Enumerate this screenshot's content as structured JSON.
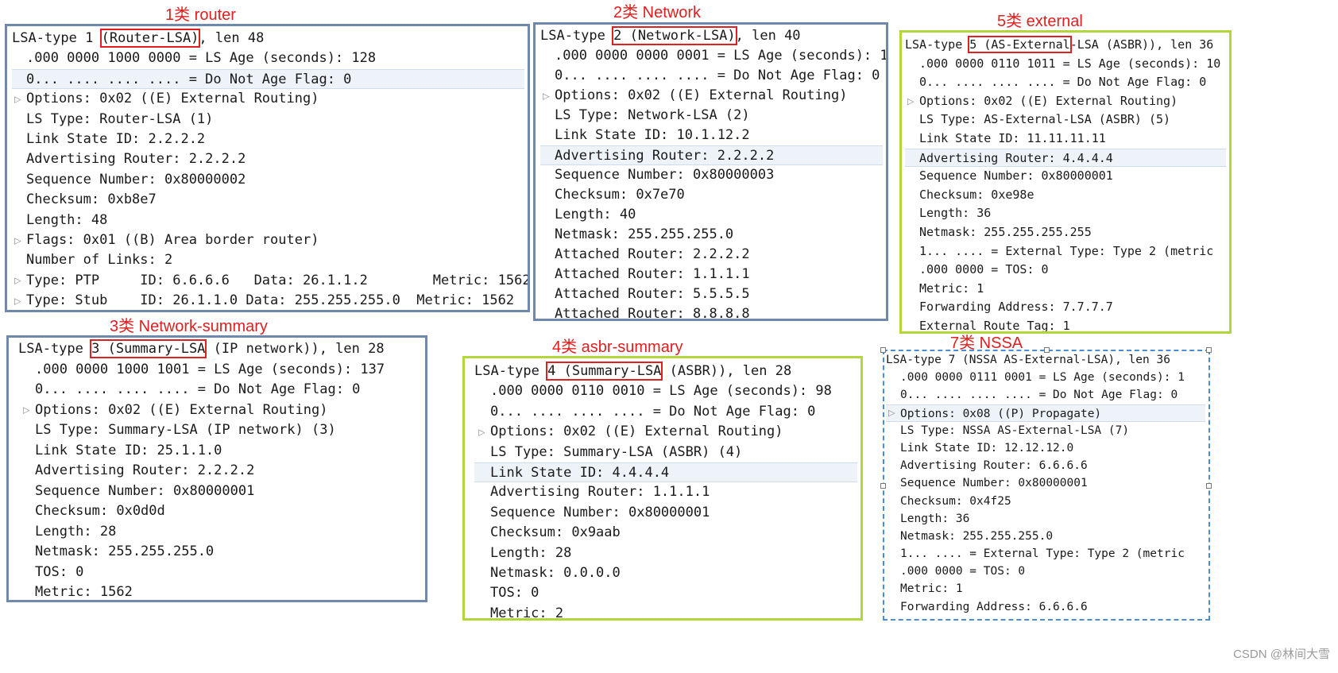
{
  "captions": {
    "p1": "1类 router",
    "p2": "2类 Network",
    "p3": "3类  Network-summary",
    "p4": "4类 asbr-summary",
    "p5": "5类 external",
    "p7": "7类  NSSA"
  },
  "watermark": "CSDN @林间大雪",
  "panels": [
    {
      "id": "p1",
      "header": {
        "pre": "LSA-type 1 ",
        "box": "(Router-LSA)",
        "post": ", len 48"
      },
      "rows": [
        {
          "text": ".000 0000 1000 0000 = LS Age (seconds): 128"
        },
        {
          "text": "0... .... .... .... = Do Not Age Flag: 0",
          "selected": true
        },
        {
          "text": "Options: 0x02 ((E) External Routing)",
          "expander": true
        },
        {
          "text": "LS Type: Router-LSA (1)"
        },
        {
          "text": "Link State ID: 2.2.2.2"
        },
        {
          "text": "Advertising Router: 2.2.2.2"
        },
        {
          "text": "Sequence Number: 0x80000002"
        },
        {
          "text": "Checksum: 0xb8e7"
        },
        {
          "text": "Length: 48"
        },
        {
          "text": "Flags: 0x01 ((B) Area border router)",
          "expander": true
        },
        {
          "text": "Number of Links: 2"
        },
        {
          "text": "Type: PTP     ID: 6.6.6.6   Data: 26.1.1.2        Metric: 1562",
          "expander": true
        },
        {
          "text": "Type: Stub    ID: 26.1.1.0 Data: 255.255.255.0  Metric: 1562",
          "expander": true
        }
      ]
    },
    {
      "id": "p2",
      "header": {
        "pre": "LSA-type ",
        "box": "2 (Network-LSA)",
        "post": ", len 40"
      },
      "rows": [
        {
          "text": ".000 0000 0000 0001 = LS Age (seconds): 1"
        },
        {
          "text": "0... .... .... .... = Do Not Age Flag: 0"
        },
        {
          "text": "Options: 0x02 ((E) External Routing)",
          "expander": true
        },
        {
          "text": "LS Type: Network-LSA (2)"
        },
        {
          "text": "Link State ID: 10.1.12.2"
        },
        {
          "text": "Advertising Router: 2.2.2.2",
          "selected": true
        },
        {
          "text": "Sequence Number: 0x80000003"
        },
        {
          "text": "Checksum: 0x7e70"
        },
        {
          "text": "Length: 40"
        },
        {
          "text": "Netmask: 255.255.255.0"
        },
        {
          "text": "Attached Router: 2.2.2.2"
        },
        {
          "text": "Attached Router: 1.1.1.1"
        },
        {
          "text": "Attached Router: 5.5.5.5"
        },
        {
          "text": "Attached Router: 8.8.8.8"
        }
      ]
    },
    {
      "id": "p3",
      "header": {
        "pre": "LSA-type ",
        "box": "3 (Summary-LSA",
        "post": " (IP network)), len 28"
      },
      "rows": [
        {
          "text": ".000 0000 1000 1001 = LS Age (seconds): 137"
        },
        {
          "text": "0... .... .... .... = Do Not Age Flag: 0"
        },
        {
          "text": "Options: 0x02 ((E) External Routing)",
          "expander": true
        },
        {
          "text": "LS Type: Summary-LSA (IP network) (3)"
        },
        {
          "text": "Link State ID: 25.1.1.0"
        },
        {
          "text": "Advertising Router: 2.2.2.2"
        },
        {
          "text": "Sequence Number: 0x80000001"
        },
        {
          "text": "Checksum: 0x0d0d"
        },
        {
          "text": "Length: 28"
        },
        {
          "text": "Netmask: 255.255.255.0"
        },
        {
          "text": "TOS: 0"
        },
        {
          "text": "Metric: 1562"
        }
      ]
    },
    {
      "id": "p4",
      "header": {
        "pre": "LSA-type ",
        "box": "4 (Summary-LSA",
        "post": " (ASBR)), len 28"
      },
      "rows": [
        {
          "text": ".000 0000 0110 0010 = LS Age (seconds): 98"
        },
        {
          "text": "0... .... .... .... = Do Not Age Flag: 0"
        },
        {
          "text": "Options: 0x02 ((E) External Routing)",
          "expander": true
        },
        {
          "text": "LS Type: Summary-LSA (ASBR) (4)"
        },
        {
          "text": "Link State ID: 4.4.4.4",
          "selected": true
        },
        {
          "text": "Advertising Router: 1.1.1.1"
        },
        {
          "text": "Sequence Number: 0x80000001"
        },
        {
          "text": "Checksum: 0x9aab"
        },
        {
          "text": "Length: 28"
        },
        {
          "text": "Netmask: 0.0.0.0"
        },
        {
          "text": "TOS: 0"
        },
        {
          "text": "Metric: 2"
        }
      ]
    },
    {
      "id": "p5",
      "header": {
        "pre": "LSA-type ",
        "box": "5 (AS-External",
        "post": "-LSA (ASBR)), len 36"
      },
      "rows": [
        {
          "text": ".000 0000 0110 1011 = LS Age (seconds): 10"
        },
        {
          "text": "0... .... .... .... = Do Not Age Flag: 0"
        },
        {
          "text": "Options: 0x02 ((E) External Routing)",
          "expander": true
        },
        {
          "text": "LS Type: AS-External-LSA (ASBR) (5)"
        },
        {
          "text": "Link State ID: 11.11.11.11"
        },
        {
          "text": "Advertising Router: 4.4.4.4",
          "selected": true
        },
        {
          "text": "Sequence Number: 0x80000001"
        },
        {
          "text": "Checksum: 0xe98e"
        },
        {
          "text": "Length: 36"
        },
        {
          "text": "Netmask: 255.255.255.255"
        },
        {
          "text": "1... .... = External Type: Type 2 (metric"
        },
        {
          "text": ".000 0000 = TOS: 0"
        },
        {
          "text": "Metric: 1"
        },
        {
          "text": "Forwarding Address: 7.7.7.7"
        },
        {
          "text": "External Route Tag: 1"
        }
      ]
    },
    {
      "id": "p7",
      "header": {
        "pre": "LSA-type 7 (NSSA AS-External-LSA), len 36",
        "box": "",
        "post": ""
      },
      "rows": [
        {
          "text": ".000 0000 0111 0001 = LS Age (seconds): 1"
        },
        {
          "text": "0... .... .... .... = Do Not Age Flag: 0"
        },
        {
          "text": "Options: 0x08 ((P) Propagate)",
          "expander": true,
          "selected": true
        },
        {
          "text": "LS Type: NSSA AS-External-LSA (7)"
        },
        {
          "text": "Link State ID: 12.12.12.0"
        },
        {
          "text": "Advertising Router: 6.6.6.6"
        },
        {
          "text": "Sequence Number: 0x80000001"
        },
        {
          "text": "Checksum: 0x4f25"
        },
        {
          "text": "Length: 36"
        },
        {
          "text": "Netmask: 255.255.255.0"
        },
        {
          "text": "1... .... = External Type: Type 2 (metric"
        },
        {
          "text": ".000 0000 = TOS: 0"
        },
        {
          "text": "Metric: 1"
        },
        {
          "text": "Forwarding Address: 6.6.6.6"
        },
        {
          "text": "External Route Tag: 1"
        }
      ]
    }
  ]
}
